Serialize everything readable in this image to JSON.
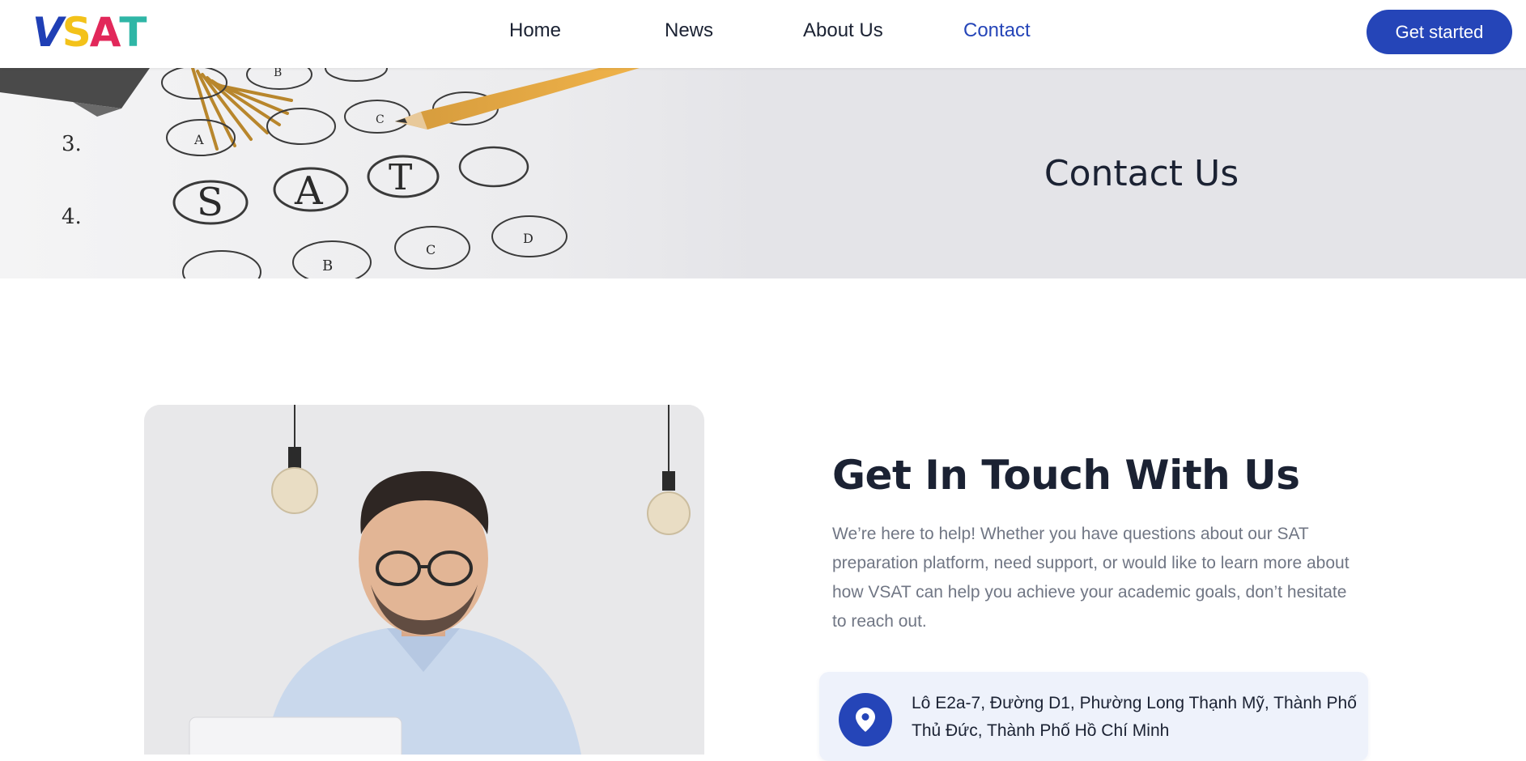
{
  "header": {
    "logo": {
      "letters": [
        "V",
        "S",
        "A",
        "T"
      ],
      "colors": [
        "#1f3fb5",
        "#f3c21a",
        "#e2285a",
        "#2fb6a6"
      ]
    },
    "nav": [
      {
        "label": "Home",
        "active": false
      },
      {
        "label": "News",
        "active": false
      },
      {
        "label": "About Us",
        "active": false
      },
      {
        "label": "Contact",
        "active": true
      }
    ],
    "cta_label": "Get started"
  },
  "banner": {
    "title": "Contact Us",
    "image": "sat-answer-sheet-with-pencil"
  },
  "main": {
    "image": "smiling-man-with-laptop",
    "heading": "Get In Touch With Us",
    "lead": "We’re here to help! Whether you have questions about our SAT preparation platform, need support, or would like to learn more about how VSAT can help you achieve your academic goals, don’t hesitate to reach out.",
    "address_icon": "map-pin-icon",
    "address": "Lô E2a-7, Đường D1, Phường Long Thạnh Mỹ, Thành Phố Thủ Đức, Thành Phố Hồ Chí Minh"
  },
  "colors": {
    "primary": "#2545b8",
    "text": "#1b2233",
    "muted": "#707684",
    "banner_bg": "#e4e4e8",
    "card_bg": "#eef2fb"
  }
}
